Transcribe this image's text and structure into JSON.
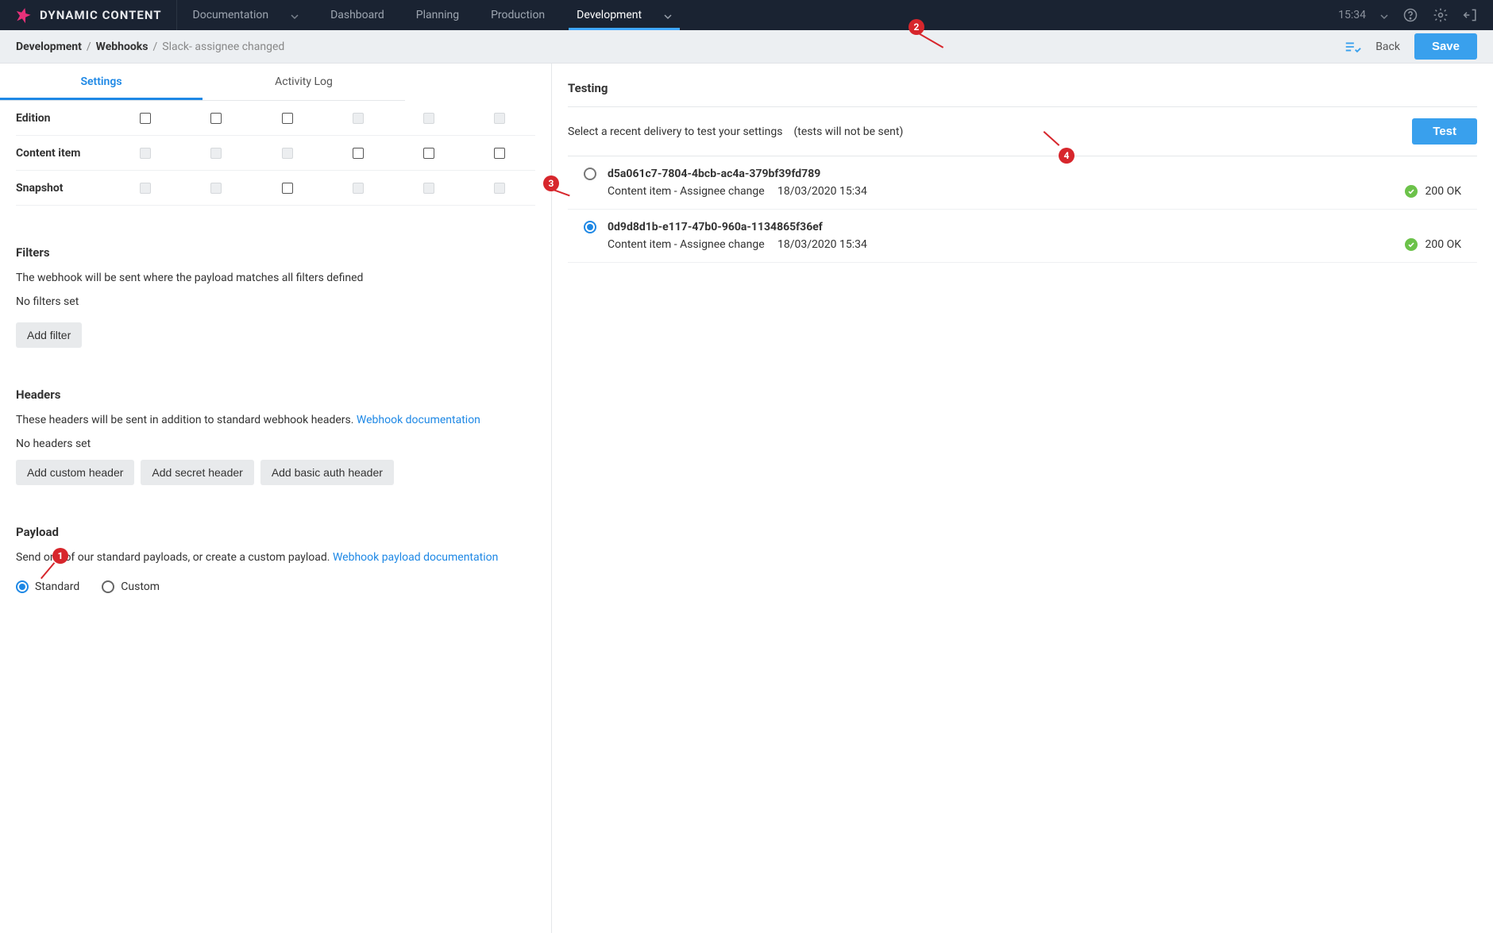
{
  "brand": "DYNAMIC CONTENT",
  "nav": {
    "items": [
      "Documentation",
      "Dashboard",
      "Planning",
      "Production",
      "Development"
    ],
    "active": "Development",
    "time": "15:34"
  },
  "breadcrumb": {
    "a": "Development",
    "b": "Webhooks",
    "c": "Slack- assignee changed"
  },
  "actions": {
    "back": "Back",
    "save": "Save"
  },
  "left_tabs": {
    "settings": "Settings",
    "log": "Activity Log"
  },
  "events": {
    "rows": [
      {
        "label": "Edition",
        "cells": [
          "e",
          "e",
          "e",
          "d",
          "d",
          "d"
        ]
      },
      {
        "label": "Content item",
        "cells": [
          "d",
          "d",
          "d",
          "e",
          "e",
          "e"
        ]
      },
      {
        "label": "Snapshot",
        "cells": [
          "d",
          "d",
          "e",
          "d",
          "d",
          "d"
        ]
      }
    ]
  },
  "filters": {
    "title": "Filters",
    "desc": "The webhook will be sent where the payload matches all filters defined",
    "empty": "No filters set",
    "add": "Add filter"
  },
  "headers": {
    "title": "Headers",
    "desc": "These headers will be sent in addition to standard webhook headers.  ",
    "doclink": "Webhook documentation",
    "empty": "No headers set",
    "buttons": [
      "Add custom header",
      "Add secret header",
      "Add basic auth header"
    ]
  },
  "payload": {
    "title": "Payload",
    "desc": "Send one of our standard payloads, or create a custom payload.  ",
    "doclink": "Webhook payload documentation",
    "options": {
      "standard": "Standard",
      "custom": "Custom"
    },
    "selected": "standard"
  },
  "testing": {
    "title": "Testing",
    "sub": "Select a recent delivery to test your settings",
    "note": "(tests will not be sent)",
    "button": "Test",
    "deliveries": [
      {
        "id": "d5a061c7-7804-4bcb-ac4a-379bf39fd789",
        "desc": "Content item - Assignee change",
        "date": "18/03/2020 15:34",
        "status": "200 OK",
        "selected": false
      },
      {
        "id": "0d9d8d1b-e117-47b0-960a-1134865f36ef",
        "desc": "Content item - Assignee change",
        "date": "18/03/2020 15:34",
        "status": "200 OK",
        "selected": true
      }
    ]
  },
  "annotations": {
    "b1": "1",
    "b2": "2",
    "b3": "3",
    "b4": "4"
  }
}
